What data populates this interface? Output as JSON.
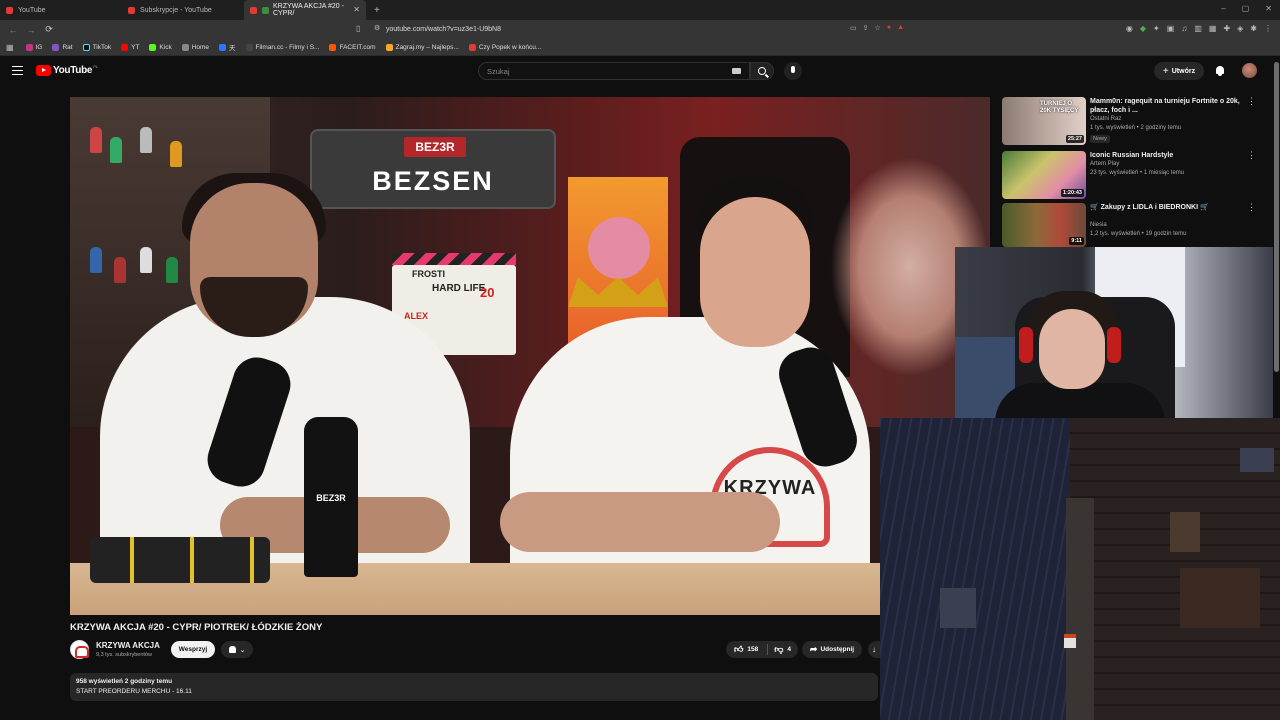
{
  "browser": {
    "tabs": [
      {
        "label": "YouTube"
      },
      {
        "label": "Subskrypcje - YouTube"
      },
      {
        "label": "KRZYWA AKCJA #20 - CYPR/"
      }
    ],
    "new_tab": "+",
    "url": "youtube.com/watch?v=uz3e1-U9bN8",
    "window_controls": [
      "–",
      "▢",
      "✕"
    ]
  },
  "bookmarks": [
    {
      "label": "IG",
      "color": "#c13584"
    },
    {
      "label": "Rat",
      "color": "#7e57c2"
    },
    {
      "label": "TikTok",
      "color": "#111111"
    },
    {
      "label": "YT",
      "color": "#ff0000"
    },
    {
      "label": "Kick",
      "color": "#53fc18"
    },
    {
      "label": "Home",
      "color": "#888888"
    },
    {
      "label": "天",
      "color": "#2979ff"
    },
    {
      "label": "Filman.cc - Filmy i S...",
      "color": "#444444"
    },
    {
      "label": "FACEIT.com",
      "color": "#ff5500"
    },
    {
      "label": "Zagraj.my – Najleps...",
      "color": "#f9a825"
    },
    {
      "label": "Czy Popek w końcu...",
      "color": "#e53935"
    }
  ],
  "youtube": {
    "logo": "YouTube",
    "country": "PL",
    "search_placeholder": "Szukaj",
    "create_label": "Utwórz"
  },
  "video": {
    "sign_small": "BEZ3R",
    "sign_big": "BEZSEN",
    "clapper_1": "FROSTI",
    "clapper_2": "HARD LIFE",
    "clapper_3": "20",
    "clapper_4": "ALEX",
    "bottle_label": "BEZ3R",
    "shirt_text": "KRZYWA",
    "title": "KRZYWA AKCJA #20 - CYPR/ PIOTREK/ ŁÓDZKIE ŻONY",
    "channel": "KRZYWA AKCJA",
    "subscribers": "9,3 tys. subskrybentów",
    "support_label": "Wesprzyj",
    "likes": "158",
    "dislikes": "4",
    "share_label": "Udostępnij",
    "views_line": "958 wyświetleń  2 godziny temu",
    "desc_line": "START PREORDERU MERCHU - 16.11"
  },
  "recommendations": [
    {
      "title": "Mamm0n: ragequit na turnieju Fortnite o 20k, płacz, foch i ...",
      "channel": "Ostatni Raz",
      "meta": "1 tys. wyświetleń • 2 godziny temu",
      "badge": "Nowy",
      "duration": "25:27",
      "thumb_text": "TURNIEJ O 20K TYSIĘCY"
    },
    {
      "title": "Iconic Russian Hardstyle",
      "channel": "Artem Play",
      "meta": "23 tys. wyświetleń • 1 miesiąc temu",
      "badge": "",
      "duration": "1:20:43",
      "thumb_text": ""
    },
    {
      "title": "🛒 Zakupy z LIDLA i BIEDRONKI 🛒",
      "channel": "Niesia",
      "meta": "1,2 tys. wyświetleń • 19 godzin temu",
      "badge": "",
      "duration": "9:11",
      "thumb_text": ""
    }
  ]
}
